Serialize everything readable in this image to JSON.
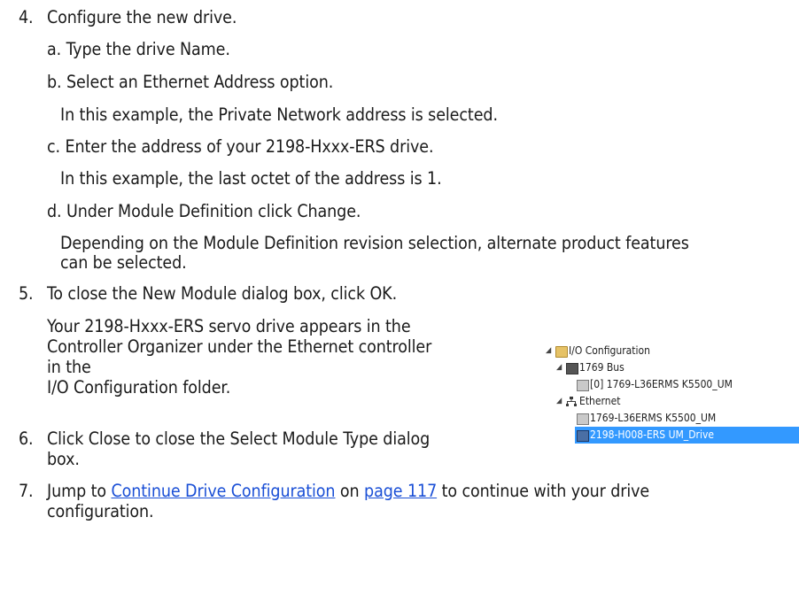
{
  "steps": {
    "s4": {
      "num": "4.",
      "text": "Configure the new drive."
    },
    "s4a": "a. Type the drive Name.",
    "s4b": "b. Select an Ethernet Address option.",
    "s4b_note": "In this example, the Private Network address is selected.",
    "s4c": "c. Enter the address of your 2198-Hxxx-ERS drive.",
    "s4c_note": "In this example, the last octet of the address is 1.",
    "s4d": "d. Under Module Definition click Change.",
    "s4d_note_1": "Depending on the Module Definition revision selection, alternate product features",
    "s4d_note_2": "can be selected.",
    "s5": {
      "num": "5.",
      "text": "To close the New Module dialog box, click OK."
    },
    "s5_note_1": "Your 2198-Hxxx-ERS servo drive appears in the",
    "s5_note_2": "Controller Organizer under the Ethernet controller",
    "s5_note_3": "in the",
    "s5_note_4": "I/O Configuration folder.",
    "s6": {
      "num": "6.",
      "text_1": "Click Close to close the Select Module Type dialog",
      "text_2": "box."
    },
    "s7": {
      "num": "7.",
      "pre": "Jump to ",
      "link1": "Continue Drive Configuration",
      "mid": " on ",
      "link2": "page 117",
      "post": " to continue with your drive",
      "text_2": "configuration."
    }
  },
  "tree": {
    "io_config": "I/O Configuration",
    "bus": "1769 Bus",
    "bus_controller": "[0] 1769-L36ERMS K5500_UM",
    "ethernet": "Ethernet",
    "eth_controller": "1769-L36ERMS K5500_UM",
    "drive": "2198-H008-ERS UM_Drive",
    "expand_glyph": "◢",
    "selected_color": "#3399ff"
  }
}
